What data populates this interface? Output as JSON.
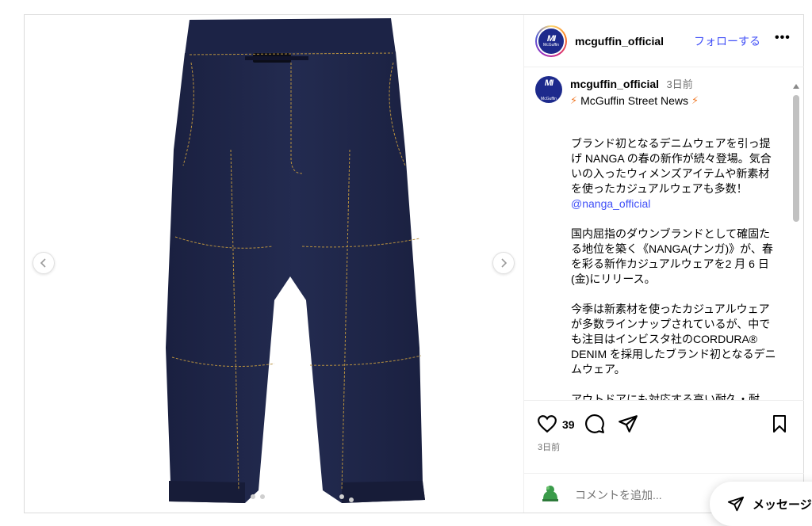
{
  "post": {
    "username": "mcguffin_official",
    "follow_label": "フォローする",
    "more_label": "•••",
    "avatar_logo_text": "McGuffin",
    "avatar_mark": "MI"
  },
  "caption": {
    "username": "mcguffin_official",
    "time": "3日前",
    "subtitle": "McGuffin Street News",
    "bolt_left": "⚡",
    "bolt_right": "⚡",
    "para1": "ブランド初となるデニムウェアを引っ提げ NANGA の春の新作が続々登場。気合いの入ったウィメンズアイテムや新素材を使ったカジュアルウェアも多数！",
    "mention": "@nanga_official",
    "para2": "国内屈指のダウンブランドとして確固たる地位を築く《NANGA(ナンガ)》が、春を彩る新作カジュアルウェアを2 月 6 日(金)にリリース。",
    "para3": "今季は新素材を使ったカジュアルウェアが多数ラインナップされているが、中でも注目はインビスタ社のCORDURA® DENIM を採用したブランド初となるデニムウェア。",
    "para4": "アウトドアにも対応する高い耐久・耐"
  },
  "actions": {
    "like_count": "39",
    "date": "3日前"
  },
  "comment": {
    "placeholder": "コメントを追加..."
  },
  "messages": {
    "label": "メッセージ"
  },
  "colors": {
    "link": "#4150f7",
    "brand_navy": "#1d2a8c",
    "denim": "#1e2545",
    "stitch": "#b8913f"
  }
}
